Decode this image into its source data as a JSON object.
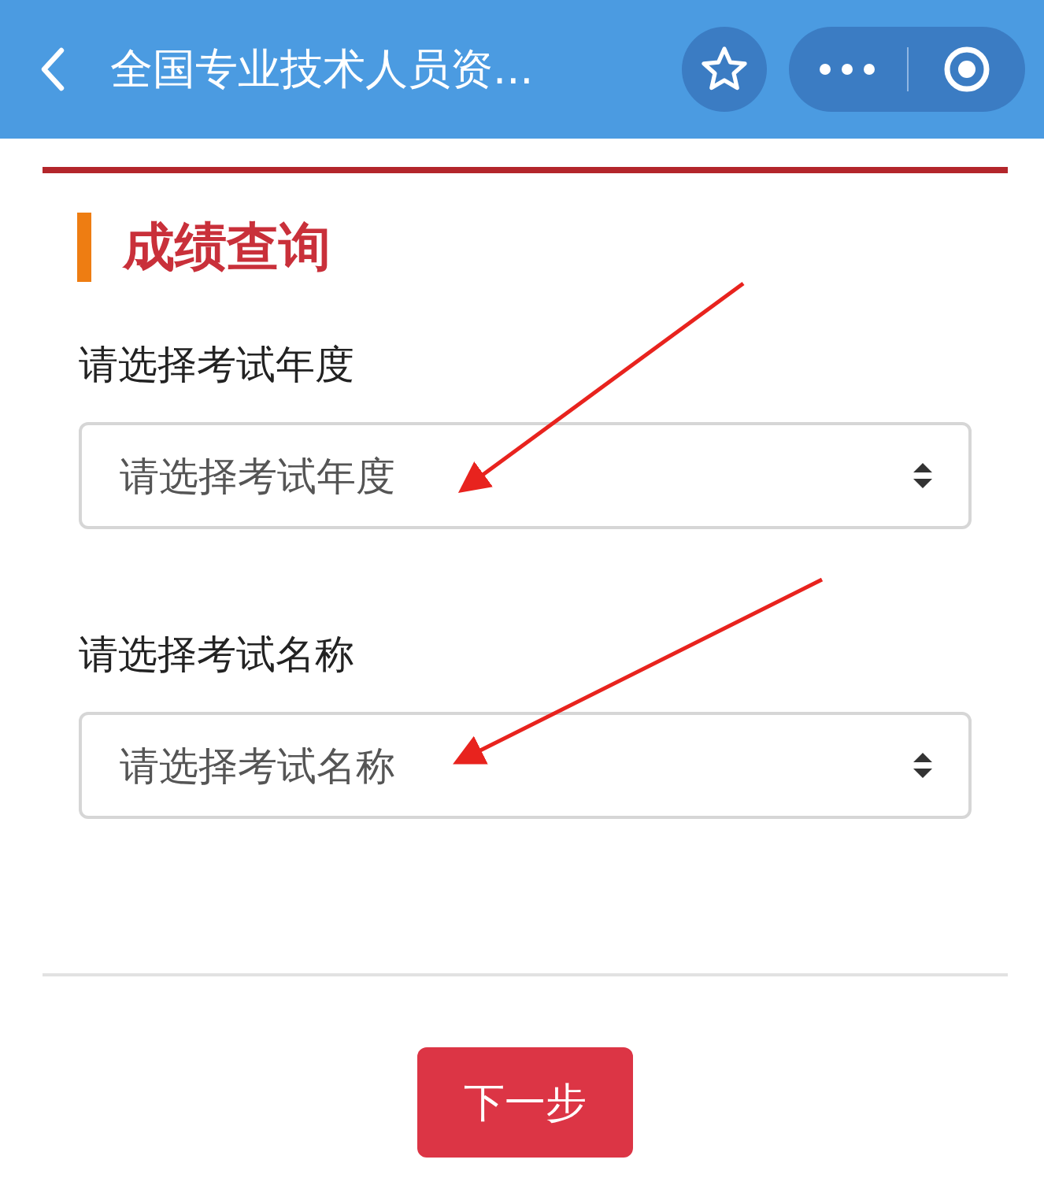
{
  "header": {
    "title": "全国专业技术人员资..."
  },
  "section": {
    "title": "成绩查询"
  },
  "fields": [
    {
      "label": "请选择考试年度",
      "placeholder": "请选择考试年度"
    },
    {
      "label": "请选择考试名称",
      "placeholder": "请选择考试名称"
    }
  ],
  "button": {
    "label": "下一步"
  }
}
